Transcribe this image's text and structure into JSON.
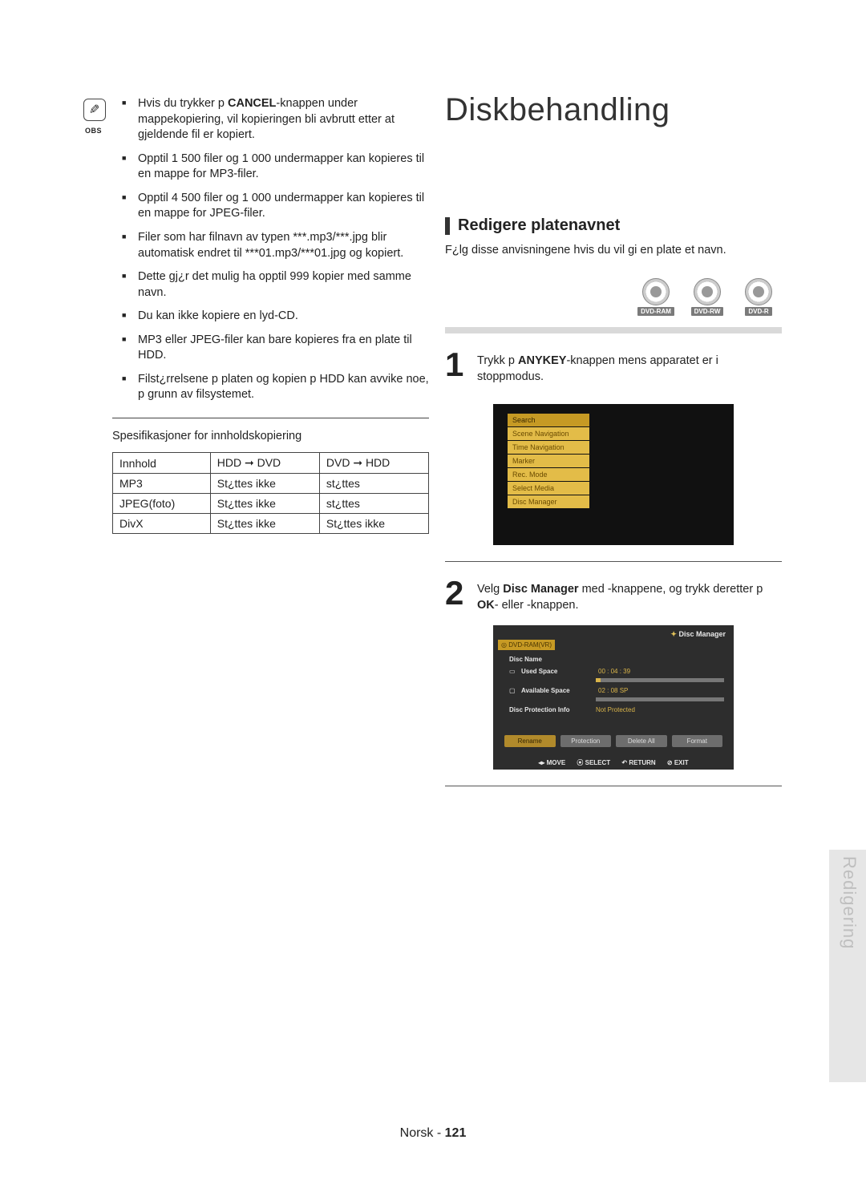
{
  "obs_label": "OBS",
  "notes": [
    {
      "pre": "Hvis du trykker p ",
      "bold": "CANCEL",
      "post": "-knappen under mappekopiering, vil kopieringen bli avbrutt etter at gjeldende fil er kopiert."
    },
    {
      "text": "Opptil 1 500 filer og 1 000 undermapper kan kopieres til en mappe for MP3-filer."
    },
    {
      "text": "Opptil 4 500 filer og 1 000 undermapper kan kopieres til en mappe for JPEG-filer."
    },
    {
      "text": "Filer som har filnavn av typen ***.mp3/***.jpg blir automatisk endret til ***01.mp3/***01.jpg og kopiert."
    },
    {
      "text": "Dette gj¿r det mulig   ha opptil 999 kopier med samme navn."
    },
    {
      "text": "Du kan ikke kopiere en lyd-CD."
    },
    {
      "text": "MP3 eller JPEG-filer kan bare kopieres fra en plate til HDD."
    },
    {
      "text": "Filst¿rrelsene p  platen og kopien p  HDD kan avvike noe, p  grunn av filsystemet."
    }
  ],
  "spec_caption": "Spesifikasjoner for innholdskopiering",
  "spec_table": {
    "headers": [
      "Innhold",
      "HDD ➞ DVD",
      "DVD ➞ HDD"
    ],
    "rows": [
      [
        "MP3",
        "St¿ttes ikke",
        "st¿ttes"
      ],
      [
        "JPEG(foto)",
        "St¿ttes ikke",
        "st¿ttes"
      ],
      [
        "DivX",
        "St¿ttes ikke",
        "St¿ttes ikke"
      ]
    ]
  },
  "chapter_title": "Diskbehandling",
  "section_title": "Redigere platenavnet",
  "section_intro": "F¿lg disse anvisningene hvis du vil gi en plate et navn.",
  "disc_badges": [
    "DVD-RAM",
    "DVD-RW",
    "DVD-R"
  ],
  "steps": [
    {
      "num": "1",
      "pre": "Trykk p  ",
      "bold": "ANYKEY",
      "post": "-knappen mens apparatet er i stoppmodus."
    },
    {
      "num": "2",
      "pre": "Velg ",
      "bold": "Disc Manager",
      "mid": " med        -knappene, og trykk deretter p  ",
      "bold2": "OK",
      "post": "- eller    -knappen."
    }
  ],
  "shot1_menu": [
    "Search",
    "Scene Navigation",
    "Time Navigation",
    "Marker",
    "Rec. Mode",
    "Select Media",
    "Disc Manager"
  ],
  "shot2": {
    "title": "Disc Manager",
    "media": "DVD-RAM(VR)",
    "rows": [
      {
        "icon": "",
        "label": "Disc Name",
        "value": ""
      },
      {
        "icon": "▭",
        "label": "Used Space",
        "value": "00 : 04 : 39"
      },
      {
        "icon": "▢",
        "label": "Available Space",
        "value": "02 : 08 SP"
      },
      {
        "icon": "",
        "label": "Disc Protection Info",
        "value": "Not Protected"
      }
    ],
    "buttons": [
      "Rename",
      "Protection",
      "Delete All",
      "Format"
    ],
    "footer": [
      "◂▸ MOVE",
      "⦿ SELECT",
      "↶ RETURN",
      "⊘ EXIT"
    ]
  },
  "side_tab": "Redigering",
  "page_footer_lang": "Norsk",
  "page_footer_dash": " - ",
  "page_footer_num": "121"
}
